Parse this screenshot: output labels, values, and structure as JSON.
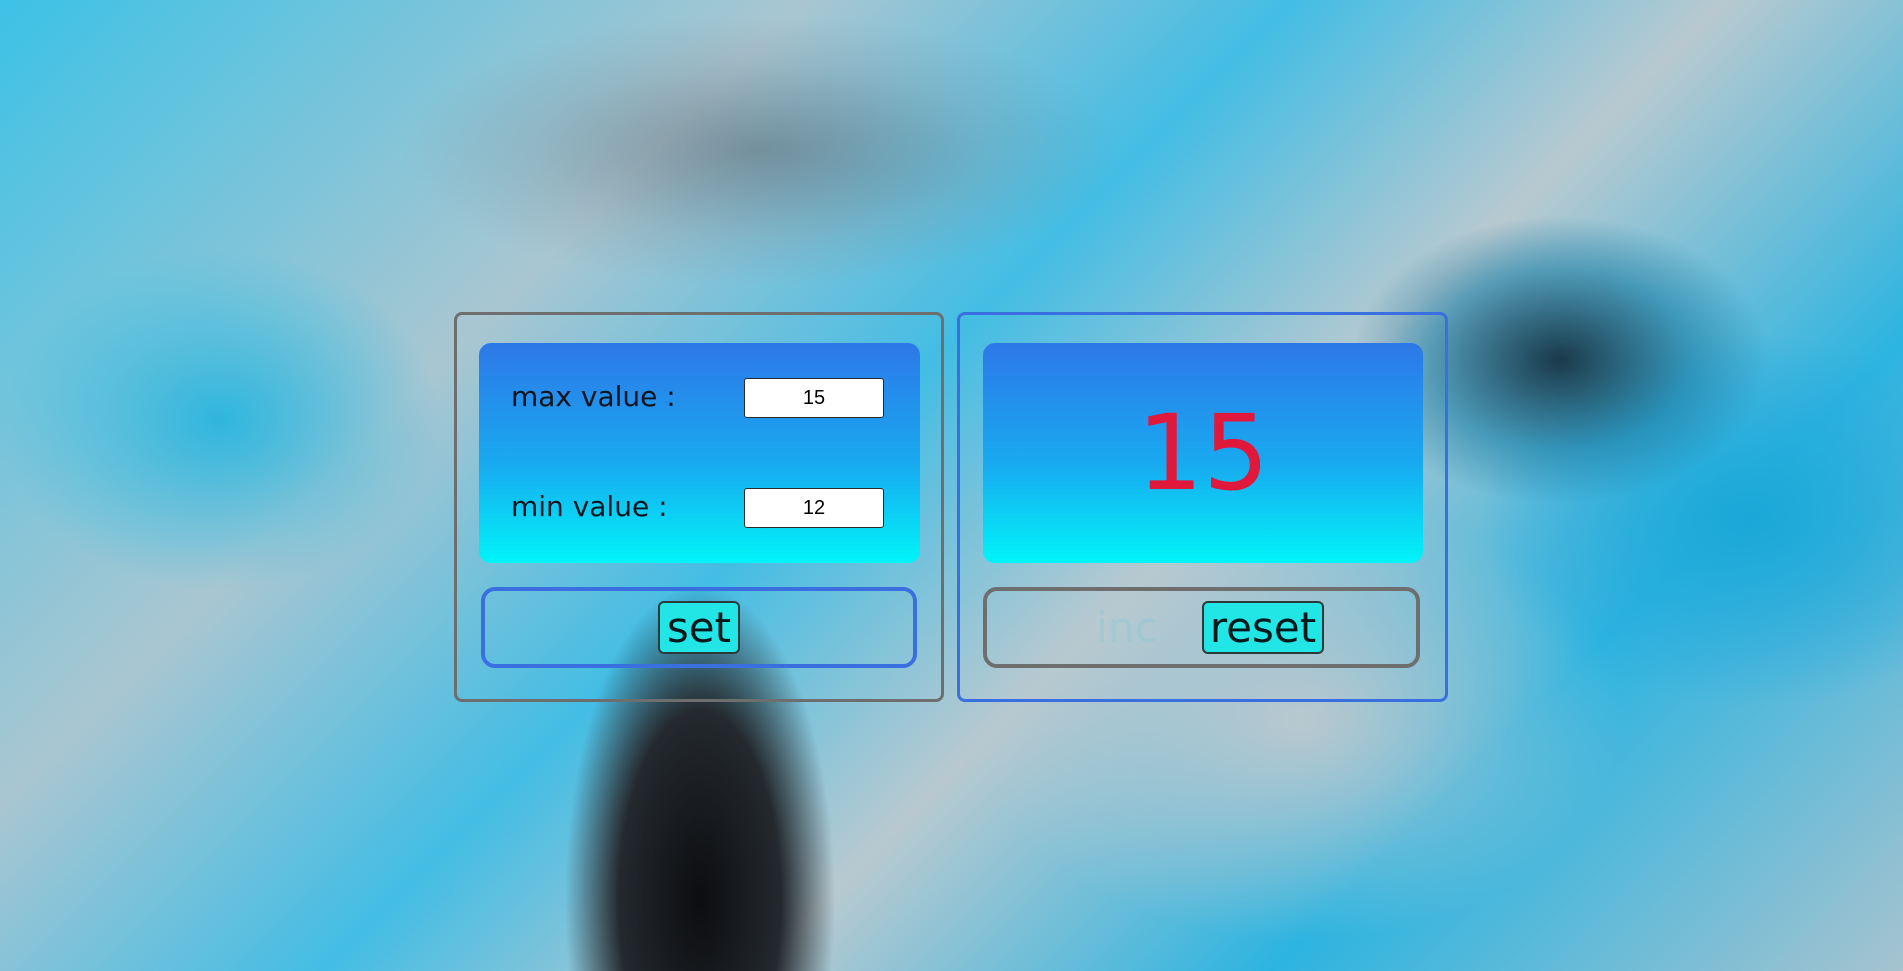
{
  "settings": {
    "max_label": "max value :",
    "max_value": "15",
    "min_label": "min value :",
    "min_value": "12",
    "set_label": "set"
  },
  "counter": {
    "value": "15",
    "inc_label": "inc",
    "reset_label": "reset"
  },
  "colors": {
    "counter_value": "#e0183c",
    "button_bg": "#22e6e6",
    "panel_blue_border": "#3a6fe0",
    "panel_gray_border": "#6e6e6e"
  }
}
